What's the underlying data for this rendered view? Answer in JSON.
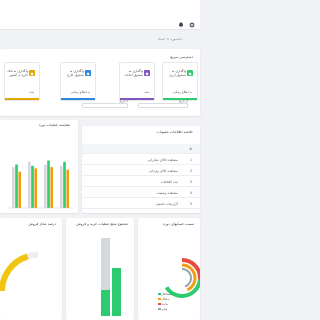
{
  "breadcrumb": "داشبورد  >  اسناد",
  "topbar": {
    "icons": [
      "bell-icon",
      "settings-icon"
    ]
  },
  "quick_access": {
    "title": "دسترسی سریع",
    "items": [
      {
        "label": "واگذاری به بانک خارج از کشور",
        "link": "ثبت",
        "color": "#e0a800"
      },
      {
        "label": "واگذاری به صندوق خارج",
        "link": "به اطلاع رسانی",
        "color": "#2e86de"
      },
      {
        "label": "واگذاری به صندوق امانات",
        "link": "ثبت",
        "color": "#7e57c2"
      },
      {
        "label": "واگذاری به صندوق ارزی",
        "link": "به اطلاع رسانی",
        "color": "#2ecc71"
      }
    ]
  },
  "filters": {
    "from_label": "از تاریخ",
    "to_label": "تا تاریخ"
  },
  "status_chart": {
    "title": "مقایسه عملیات دوره",
    "colors": {
      "green": "#2ecc71",
      "orange": "#f39c12",
      "gray": "#d5d8dc"
    }
  },
  "report_list": {
    "title": "خلاصه اطلاعات مصوبات",
    "header_num": "#",
    "rows": [
      {
        "num": "1",
        "text": "مشاهده کالای صادراتی"
      },
      {
        "num": "2",
        "text": "مشاهده کالای وارداتی"
      },
      {
        "num": "3",
        "text": "ثبت اطلاعات"
      },
      {
        "num": "4",
        "text": "مشاهده وضعیت"
      },
      {
        "num": "5",
        "text": "گزارشات تکمیلی"
      }
    ]
  },
  "bottom_charts": {
    "gauge_title": "درصد مجاز فروش",
    "bars_title": "مجموع مبلغ عملیات خرید و فروش",
    "donut_title": "نسبت حسابهای دوره",
    "donut_legend": [
      {
        "label": "بستانکار",
        "color": "#2ecc71"
      },
      {
        "label": "بدهکار",
        "color": "#f39c12"
      },
      {
        "label": "مانده",
        "color": "#e74c3c"
      },
      {
        "label": "سایر",
        "color": "#95a5a6"
      }
    ]
  }
}
